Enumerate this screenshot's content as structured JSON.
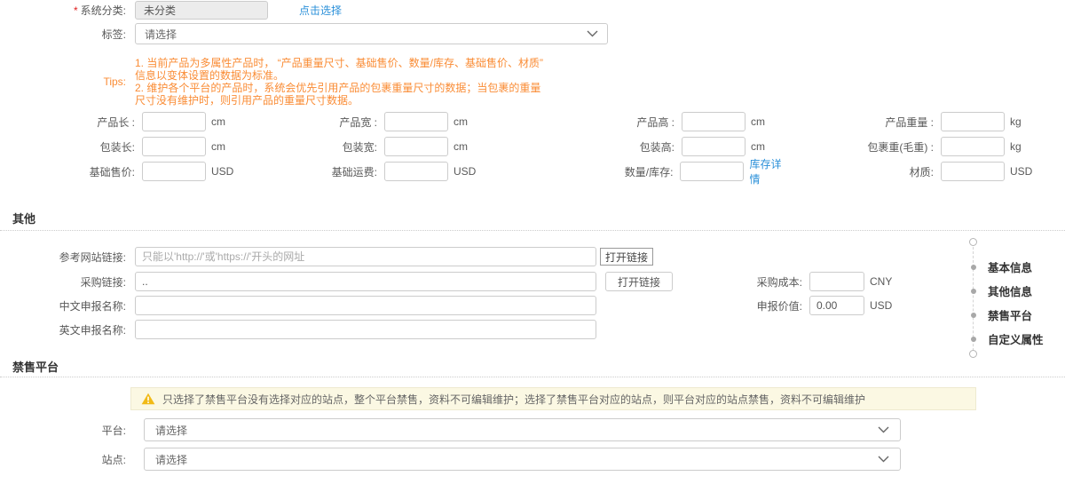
{
  "colors": {
    "link_blue": "#2b90d9",
    "tips_orange": "#fa8c35",
    "required_red": "#e02020",
    "warning_bg": "#fbf8e3",
    "warning_icon_yellow": "#f1ba17"
  },
  "system_category": {
    "required_mark": "*",
    "label": "系统分类:",
    "value": "未分类",
    "action_link": "点击选择"
  },
  "tags": {
    "label": "标签:",
    "selected": "请选择"
  },
  "tips": {
    "label": "Tips:",
    "items": [
      "1. 当前产品为多属性产品时， “产品重量尺寸、基础售价、数量/库存、基础售价、材质” 信息以变体设置的数据为标准。",
      "2. 维护各个平台的产品时，系统会优先引用产品的包裹重量尺寸的数据；当包裹的重量尺寸没有维护时，则引用产品的重量尺寸数据。"
    ]
  },
  "dims": {
    "cells": [
      {
        "label": "产品长 :",
        "unit": "cm"
      },
      {
        "label": "产品宽 :",
        "unit": "cm"
      },
      {
        "label": "产品高 :",
        "unit": "cm"
      },
      {
        "label": "产品重量 :",
        "unit": "kg"
      },
      {
        "label": "包装长:",
        "unit": "cm"
      },
      {
        "label": "包装宽:",
        "unit": "cm"
      },
      {
        "label": "包装高:",
        "unit": "cm"
      },
      {
        "label": "包裹重(毛重) :",
        "unit": "kg"
      },
      {
        "label": "基础售价:",
        "unit": "USD"
      },
      {
        "label": "基础运费:",
        "unit": "USD"
      },
      {
        "label": "数量/库存:",
        "link": "库存详情"
      },
      {
        "label": "材质:",
        "unit": "USD"
      }
    ]
  },
  "other": {
    "title": "其他",
    "reference_link": {
      "label": "参考网站链接:",
      "placeholder": "只能以'http://'或'https://'开头的网址",
      "button": "打开链接"
    },
    "purchase_link": {
      "label": "采购链接:",
      "value": "..",
      "button": "打开链接"
    },
    "cn_declare_name": {
      "label": "中文申报名称:"
    },
    "en_declare_name": {
      "label": "英文申报名称:"
    },
    "purchase_cost": {
      "label": "采购成本:",
      "unit": "CNY"
    },
    "declare_value": {
      "label": "申报价值:",
      "value": "0.00",
      "unit": "USD"
    }
  },
  "anchor_nav": {
    "items": [
      {
        "label": "基本信息"
      },
      {
        "label": "其他信息"
      },
      {
        "label": "禁售平台"
      },
      {
        "label": "自定义属性"
      }
    ]
  },
  "banned_platform": {
    "title": "禁售平台",
    "warning": "只选择了禁售平台没有选择对应的站点，整个平台禁售，资料不可编辑维护；选择了禁售平台对应的站点，则平台对应的站点禁售，资料不可编辑维护",
    "platform": {
      "label": "平台:",
      "selected": "请选择"
    },
    "site": {
      "label": "站点:",
      "selected": "请选择"
    }
  }
}
